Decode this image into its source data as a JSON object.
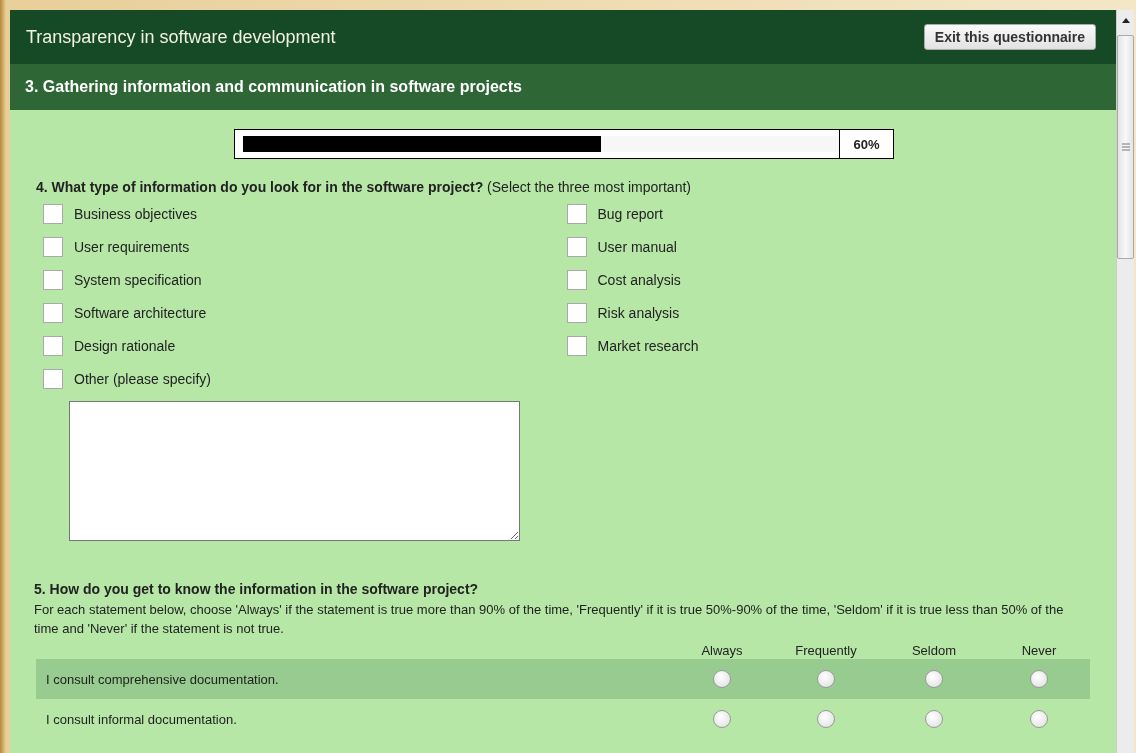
{
  "window": {
    "title": "Transparency in software development",
    "exit_button": "Exit this questionnaire"
  },
  "section": {
    "title": "3. Gathering information and communication in software projects"
  },
  "progress": {
    "level": 0.6,
    "reading": "60%"
  },
  "question_4": {
    "title": "4. What type of information do you look for in the software project?",
    "hint": "(Select the three most important)",
    "columns": [
      [
        {
          "label": "Business objectives",
          "checked": false
        },
        {
          "label": "User requirements",
          "checked": false
        },
        {
          "label": "System specification",
          "checked": false
        },
        {
          "label": "Software architecture",
          "checked": false
        },
        {
          "label": "Design rationale",
          "checked": false
        },
        {
          "label": "Other (please specify)",
          "checked": false
        }
      ],
      [
        {
          "label": "Bug report",
          "checked": false
        },
        {
          "label": "User manual",
          "checked": false
        },
        {
          "label": "Cost analysis",
          "checked": false
        },
        {
          "label": "Risk analysis",
          "checked": false
        },
        {
          "label": "Market research",
          "checked": false
        }
      ]
    ]
  },
  "question_5": {
    "title": "5. How do you get to know the information in the software project?",
    "description": "For each statement below, choose 'Always' if the statement is true more than 90% of the time, 'Frequently' if it is true 50%-90% of the time, 'Seldom' if it is true less than 50% of the time and 'Never' if the statement is not true.",
    "columns": [
      "Always",
      "Frequently",
      "Seldom",
      "Never"
    ],
    "rows": [
      {
        "statement": "I consult comprehensive documentation.",
        "highlighted": true,
        "options": [
          {
            "selected": false
          },
          {
            "selected": false
          },
          {
            "selected": false
          },
          {
            "selected": false
          }
        ]
      },
      {
        "statement": "I consult informal documentation.",
        "highlighted": false,
        "options": [
          {
            "selected": false
          },
          {
            "selected": false
          },
          {
            "selected": false
          },
          {
            "selected": false
          }
        ]
      }
    ]
  }
}
